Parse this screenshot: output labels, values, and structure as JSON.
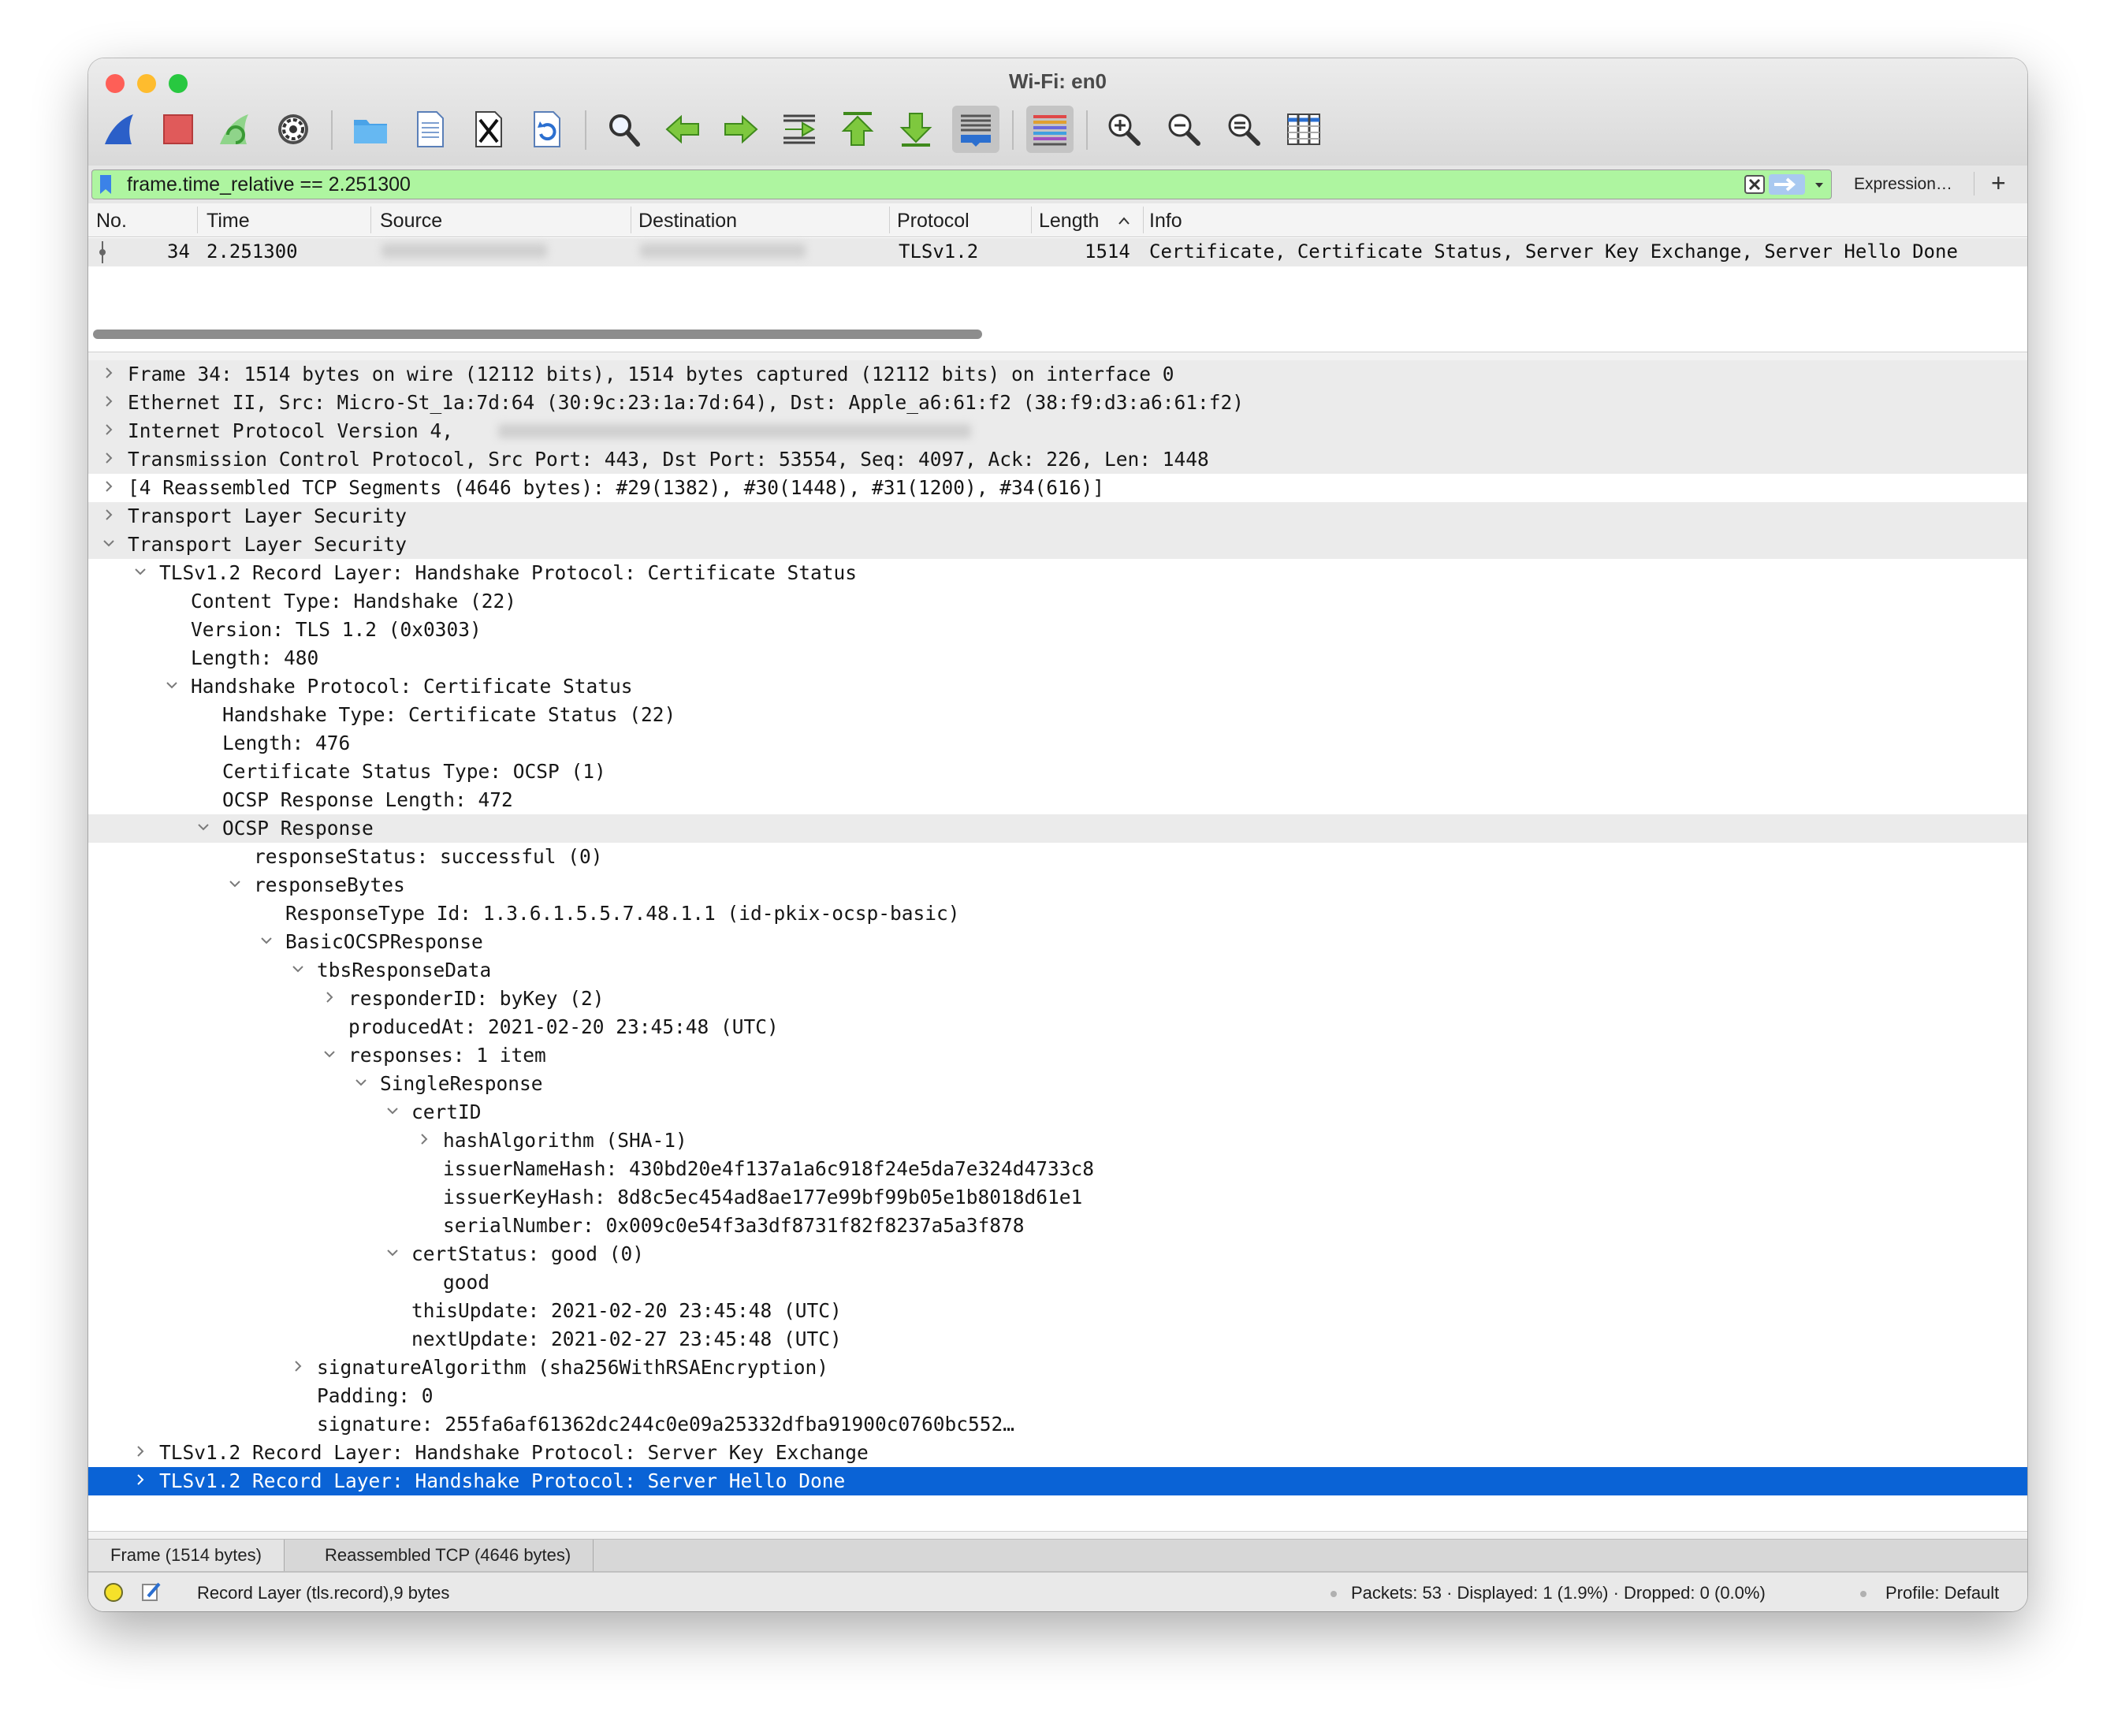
{
  "window": {
    "title": "Wi-Fi: en0"
  },
  "toolbar": {
    "buttons": [
      {
        "name": "start-capture",
        "icon": "shark-fin-icon"
      },
      {
        "name": "stop-capture",
        "icon": "stop-square-icon"
      },
      {
        "name": "restart-capture",
        "icon": "restart-fin-icon"
      },
      {
        "name": "capture-options",
        "icon": "gear-icon"
      },
      {
        "name": "open-file",
        "icon": "folder-icon"
      },
      {
        "name": "save-file",
        "icon": "file-document-icon"
      },
      {
        "name": "close-file",
        "icon": "close-file-icon"
      },
      {
        "name": "reload-file",
        "icon": "reload-icon"
      },
      {
        "name": "find-packet",
        "icon": "magnifier-icon"
      },
      {
        "name": "go-back",
        "icon": "arrow-left-icon"
      },
      {
        "name": "go-forward",
        "icon": "arrow-right-icon"
      },
      {
        "name": "go-to-packet",
        "icon": "go-to-packet-icon"
      },
      {
        "name": "go-to-first",
        "icon": "arrow-up-bar-icon"
      },
      {
        "name": "go-to-last",
        "icon": "arrow-down-bar-icon"
      },
      {
        "name": "auto-scroll",
        "icon": "auto-scroll-icon"
      },
      {
        "name": "colorize",
        "icon": "colorize-lines-icon"
      },
      {
        "name": "zoom-in",
        "icon": "zoom-in-icon"
      },
      {
        "name": "zoom-out",
        "icon": "zoom-out-icon"
      },
      {
        "name": "normal-size",
        "icon": "zoom-normal-icon"
      },
      {
        "name": "resize-columns",
        "icon": "resize-columns-icon"
      }
    ]
  },
  "filter": {
    "value": "frame.time_relative == 2.251300",
    "expression_label": "Expression…",
    "add_label": "+",
    "bg_color": "#aef5a0"
  },
  "packet_list": {
    "columns": [
      "No.",
      "Time",
      "Source",
      "Destination",
      "Protocol",
      "Length",
      "Info"
    ],
    "rows": [
      {
        "no": "34",
        "time": "2.251300",
        "source": "",
        "destination": "",
        "protocol": "TLSv1.2",
        "length": "1514",
        "info": "Certificate, Certificate Status, Server Key Exchange, Server Hello Done"
      }
    ]
  },
  "details": [
    {
      "text": "Frame 34: 1514 bytes on wire (12112 bits), 1514 bytes captured (12112 bits) on interface 0",
      "depth": 0,
      "state": "collapsed",
      "alt": true
    },
    {
      "text": "Ethernet II, Src: Micro-St_1a:7d:64 (30:9c:23:1a:7d:64), Dst: Apple_a6:61:f2 (38:f9:d3:a6:61:f2)",
      "depth": 0,
      "state": "collapsed",
      "alt": true
    },
    {
      "text": "Internet Protocol Version 4,",
      "depth": 0,
      "state": "collapsed",
      "alt": true,
      "blur": true
    },
    {
      "text": "Transmission Control Protocol, Src Port: 443, Dst Port: 53554, Seq: 4097, Ack: 226, Len: 1448",
      "depth": 0,
      "state": "collapsed",
      "alt": true
    },
    {
      "text": "[4 Reassembled TCP Segments (4646 bytes): #29(1382), #30(1448), #31(1200), #34(616)]",
      "depth": 0,
      "state": "collapsed",
      "alt": false
    },
    {
      "text": "Transport Layer Security",
      "depth": 0,
      "state": "collapsed",
      "alt": true
    },
    {
      "text": "Transport Layer Security",
      "depth": 0,
      "state": "expanded",
      "alt": true
    },
    {
      "text": "TLSv1.2 Record Layer: Handshake Protocol: Certificate Status",
      "depth": 1,
      "state": "expanded",
      "alt": false
    },
    {
      "text": "Content Type: Handshake (22)",
      "depth": 2,
      "state": "leaf",
      "alt": false
    },
    {
      "text": "Version: TLS 1.2 (0x0303)",
      "depth": 2,
      "state": "leaf",
      "alt": false
    },
    {
      "text": "Length: 480",
      "depth": 2,
      "state": "leaf",
      "alt": false
    },
    {
      "text": "Handshake Protocol: Certificate Status",
      "depth": 2,
      "state": "expanded",
      "alt": false
    },
    {
      "text": "Handshake Type: Certificate Status (22)",
      "depth": 3,
      "state": "leaf",
      "alt": false
    },
    {
      "text": "Length: 476",
      "depth": 3,
      "state": "leaf",
      "alt": false
    },
    {
      "text": "Certificate Status Type: OCSP (1)",
      "depth": 3,
      "state": "leaf",
      "alt": false
    },
    {
      "text": "OCSP Response Length: 472",
      "depth": 3,
      "state": "leaf",
      "alt": false
    },
    {
      "text": "OCSP Response",
      "depth": 3,
      "state": "expanded",
      "alt": true
    },
    {
      "text": "responseStatus: successful (0)",
      "depth": 4,
      "state": "leaf",
      "alt": false
    },
    {
      "text": "responseBytes",
      "depth": 4,
      "state": "expanded",
      "alt": false
    },
    {
      "text": "ResponseType Id: 1.3.6.1.5.5.7.48.1.1 (id-pkix-ocsp-basic)",
      "depth": 5,
      "state": "leaf",
      "alt": false
    },
    {
      "text": "BasicOCSPResponse",
      "depth": 5,
      "state": "expanded",
      "alt": false
    },
    {
      "text": "tbsResponseData",
      "depth": 6,
      "state": "expanded",
      "alt": false
    },
    {
      "text": "responderID: byKey (2)",
      "depth": 7,
      "state": "collapsed",
      "alt": false
    },
    {
      "text": "producedAt: 2021-02-20 23:45:48 (UTC)",
      "depth": 7,
      "state": "leaf",
      "alt": false
    },
    {
      "text": "responses: 1 item",
      "depth": 7,
      "state": "expanded",
      "alt": false
    },
    {
      "text": "SingleResponse",
      "depth": 8,
      "state": "expanded",
      "alt": false
    },
    {
      "text": "certID",
      "depth": 9,
      "state": "expanded",
      "alt": false
    },
    {
      "text": "hashAlgorithm (SHA-1)",
      "depth": 10,
      "state": "collapsed",
      "alt": false
    },
    {
      "text": "issuerNameHash: 430bd20e4f137a1a6c918f24e5da7e324d4733c8",
      "depth": 10,
      "state": "leaf",
      "alt": false
    },
    {
      "text": "issuerKeyHash: 8d8c5ec454ad8ae177e99bf99b05e1b8018d61e1",
      "depth": 10,
      "state": "leaf",
      "alt": false
    },
    {
      "text": "serialNumber: 0x009c0e54f3a3df8731f82f8237a5a3f878",
      "depth": 10,
      "state": "leaf",
      "alt": false
    },
    {
      "text": "certStatus: good (0)",
      "depth": 9,
      "state": "expanded",
      "alt": false
    },
    {
      "text": "good",
      "depth": 10,
      "state": "leaf",
      "alt": false
    },
    {
      "text": "thisUpdate: 2021-02-20 23:45:48 (UTC)",
      "depth": 9,
      "state": "leaf",
      "alt": false
    },
    {
      "text": "nextUpdate: 2021-02-27 23:45:48 (UTC)",
      "depth": 9,
      "state": "leaf",
      "alt": false
    },
    {
      "text": "signatureAlgorithm (sha256WithRSAEncryption)",
      "depth": 6,
      "state": "collapsed",
      "alt": false
    },
    {
      "text": "Padding: 0",
      "depth": 6,
      "state": "leaf",
      "alt": false
    },
    {
      "text": "signature: 255fa6af61362dc244c0e09a25332dfba91900c0760bc552…",
      "depth": 6,
      "state": "leaf",
      "alt": false
    },
    {
      "text": "TLSv1.2 Record Layer: Handshake Protocol: Server Key Exchange",
      "depth": 1,
      "state": "collapsed",
      "alt": false
    },
    {
      "text": "TLSv1.2 Record Layer: Handshake Protocol: Server Hello Done",
      "depth": 1,
      "state": "collapsed",
      "alt": false,
      "selected": true
    }
  ],
  "byte_tabs": [
    "Frame (1514 bytes)",
    "Reassembled TCP (4646 bytes)"
  ],
  "status": {
    "field": "Record Layer (tls.record),9 bytes",
    "packets": "Packets: 53 · Displayed: 1 (1.9%) · Dropped: 0 (0.0%)",
    "profile": "Profile: Default"
  },
  "colors": {
    "selection": "#0a63d6",
    "filter_valid": "#aef5a0",
    "close_red": "#fe5f57",
    "minimize_yellow": "#febc2e",
    "zoom_green": "#28c840"
  }
}
